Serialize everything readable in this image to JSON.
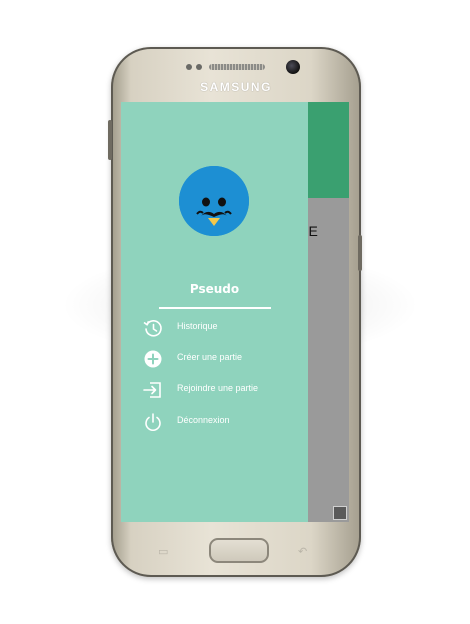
{
  "device": {
    "brand": "SAMSUNG"
  },
  "background_screen": {
    "title_fragment": "TIE"
  },
  "drawer": {
    "username": "Pseudo",
    "menu": [
      {
        "label": "Historique",
        "icon": "history-icon"
      },
      {
        "label": "Créer une partie",
        "icon": "add-circle-icon"
      },
      {
        "label": "Rejoindre une partie",
        "icon": "login-icon"
      },
      {
        "label": "Déconnexion",
        "icon": "power-icon"
      }
    ]
  },
  "colors": {
    "drawer_bg": "#8fd3bd",
    "header_green": "#3aa070",
    "avatar_blue": "#1d8fd3",
    "beak_yellow": "#f2c84b"
  }
}
